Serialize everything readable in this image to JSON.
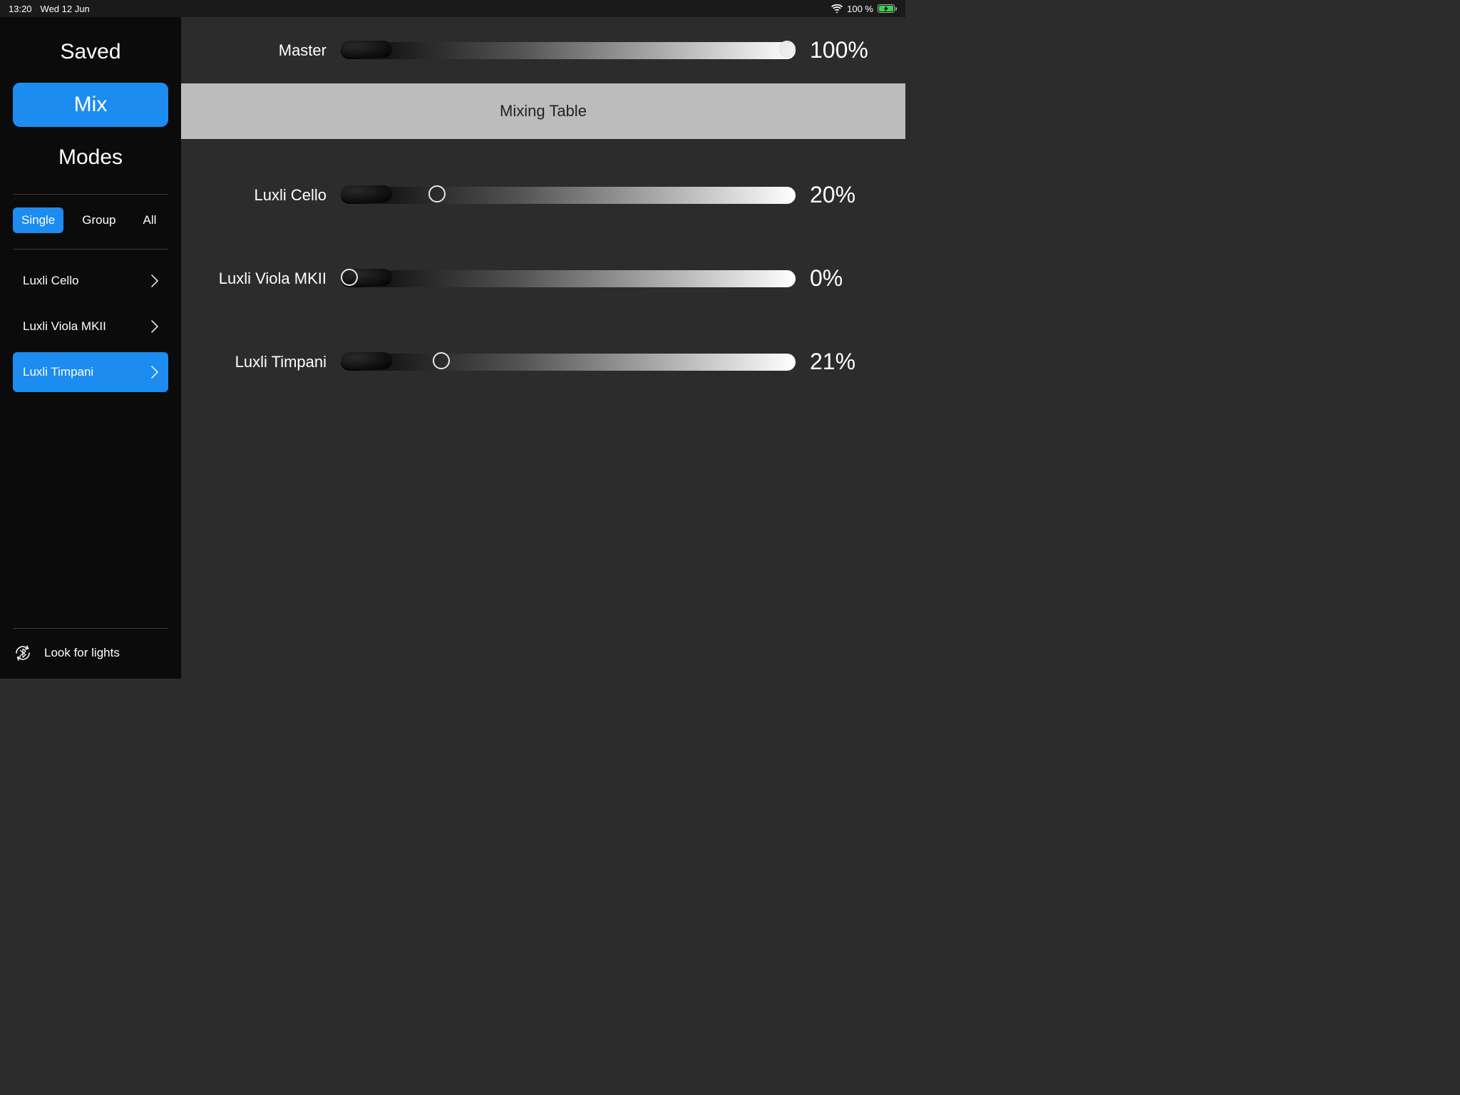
{
  "status_bar": {
    "time": "13:20",
    "date": "Wed 12 Jun",
    "battery_pct": "100 %"
  },
  "sidebar": {
    "nav": {
      "saved": "Saved",
      "mix": "Mix",
      "modes": "Modes"
    },
    "filters": {
      "single": "Single",
      "group": "Group",
      "all": "All"
    },
    "devices": [
      {
        "label": "Luxli Cello",
        "active": false
      },
      {
        "label": "Luxli Viola MKII",
        "active": false
      },
      {
        "label": "Luxli Timpani",
        "active": true
      }
    ],
    "look_for_lights": "Look for lights"
  },
  "main": {
    "master": {
      "label": "Master",
      "value": 100,
      "display": "100%"
    },
    "mixing_table_title": "Mixing Table",
    "channels": [
      {
        "label": "Luxli Cello",
        "value": 20,
        "display": "20%"
      },
      {
        "label": "Luxli Viola MKII",
        "value": 0,
        "display": "0%"
      },
      {
        "label": "Luxli Timpani",
        "value": 21,
        "display": "21%"
      }
    ]
  },
  "colors": {
    "accent": "#1c8cf0",
    "bg_main": "#2c2c2c",
    "bg_sidebar": "#0b0b0b",
    "mixing_header_bg": "#bcbcbc"
  }
}
